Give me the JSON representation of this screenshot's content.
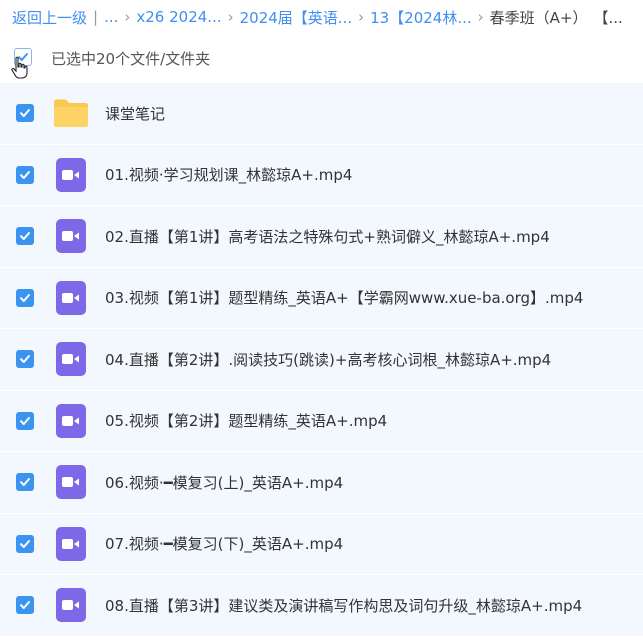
{
  "breadcrumb": {
    "back_label": "返回上一级",
    "sep": "|",
    "items": [
      "...",
      "x26 2024...",
      "2024届【英语...",
      "13【2024林...",
      "春季班（A+）",
      "【..."
    ]
  },
  "selection": {
    "text": "已选中20个文件/文件夹"
  },
  "files": [
    {
      "name": "课堂笔记",
      "type": "folder",
      "icon": "folder-icon"
    },
    {
      "name": "01.视频·学习规划课_林懿琼A+.mp4",
      "type": "video",
      "icon": "video-file-icon"
    },
    {
      "name": "02.直播【第1讲】高考语法之特殊句式+熟词僻义_林懿琼A+.mp4",
      "type": "video",
      "icon": "video-file-icon"
    },
    {
      "name": "03.视频【第1讲】题型精练_英语A+【学霸网www.xue-ba.org】.mp4",
      "type": "video",
      "icon": "video-file-icon"
    },
    {
      "name": "04.直播【第2讲】.阅读技巧(跳读)+高考核心词根_林懿琼A+.mp4",
      "type": "video",
      "icon": "video-file-icon"
    },
    {
      "name": "05.视频【第2讲】题型精练_英语A+.mp4",
      "type": "video",
      "icon": "video-file-icon"
    },
    {
      "name": "06.视频·━模复习(上)_英语A+.mp4",
      "type": "video",
      "icon": "video-file-icon"
    },
    {
      "name": "07.视频·━模复习(下)_英语A+.mp4",
      "type": "video",
      "icon": "video-file-icon"
    },
    {
      "name": "08.直播【第3讲】建议类及演讲稿写作构思及词句升级_林懿琼A+.mp4",
      "type": "video",
      "icon": "video-file-icon"
    }
  ],
  "colors": {
    "link": "#3f8ef0",
    "checkbox": "#3b95f0",
    "row_bg": "#f3f8fe",
    "folder": "#fbc84e",
    "video": "#7d69e8"
  }
}
